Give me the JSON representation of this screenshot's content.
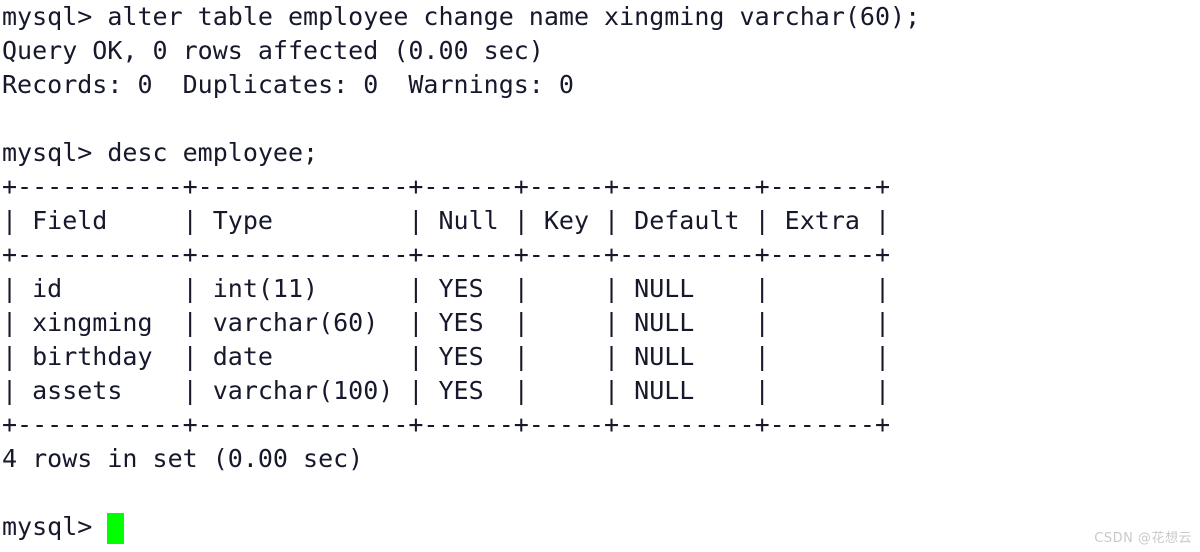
{
  "terminal": {
    "title": "MySQL command line client",
    "prompt": "mysql> ",
    "background_color": "#ffffff",
    "text_color": "#16182b",
    "cursor_color": "#00ff00",
    "lines": [
      {
        "id": "cmd-alter-table",
        "text": "mysql> alter table employee change name xingming varchar(60);",
        "kind": "command"
      },
      {
        "id": "result-query-ok",
        "text": "Query OK, 0 rows affected (0.00 sec)",
        "kind": "result"
      },
      {
        "id": "result-records",
        "text": "Records: 0  Duplicates: 0  Warnings: 0",
        "kind": "result"
      },
      {
        "id": "blank-1",
        "text": "",
        "kind": "blank"
      },
      {
        "id": "cmd-desc-employee",
        "text": "mysql> desc employee;",
        "kind": "command"
      },
      {
        "id": "table-top-border",
        "text": "+-----------+--------------+------+-----+---------+-------+",
        "kind": "border"
      },
      {
        "id": "table-header-row",
        "text": "| Field     | Type         | Null | Key | Default | Extra |",
        "kind": "header"
      },
      {
        "id": "table-header-sep",
        "text": "+-----------+--------------+------+-----+---------+-------+",
        "kind": "border"
      },
      {
        "id": "table-row-id",
        "text": "| id        | int(11)      | YES  |     | NULL    |       |",
        "kind": "row"
      },
      {
        "id": "table-row-xingming",
        "text": "| xingming  | varchar(60)  | YES  |     | NULL    |       |",
        "kind": "row"
      },
      {
        "id": "table-row-birthday",
        "text": "| birthday  | date         | YES  |     | NULL    |       |",
        "kind": "row"
      },
      {
        "id": "table-row-assets",
        "text": "| assets    | varchar(100) | YES  |     | NULL    |       |",
        "kind": "row"
      },
      {
        "id": "table-bottom-border",
        "text": "+-----------+--------------+------+-----+---------+-------+",
        "kind": "border"
      },
      {
        "id": "result-rows-in-set",
        "text": "4 rows in set (0.00 sec)",
        "kind": "result"
      },
      {
        "id": "blank-2",
        "text": "",
        "kind": "blank"
      }
    ],
    "current_prompt": {
      "text": "mysql> ",
      "input_value": ""
    },
    "described_table": {
      "table_name": "employee",
      "columns": [
        "Field",
        "Type",
        "Null",
        "Key",
        "Default",
        "Extra"
      ],
      "rows": [
        [
          "id",
          "int(11)",
          "YES",
          "",
          "NULL",
          ""
        ],
        [
          "xingming",
          "varchar(60)",
          "YES",
          "",
          "NULL",
          ""
        ],
        [
          "birthday",
          "date",
          "YES",
          "",
          "NULL",
          ""
        ],
        [
          "assets",
          "varchar(100)",
          "YES",
          "",
          "NULL",
          ""
        ]
      ],
      "row_count_text": "4 rows in set (0.00 sec)"
    }
  },
  "watermark": {
    "text": "CSDN @花想云"
  }
}
